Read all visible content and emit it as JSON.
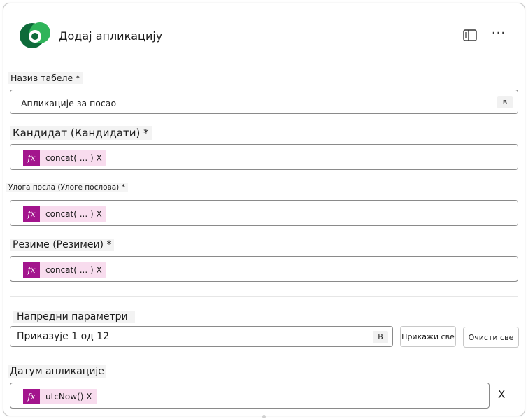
{
  "header": {
    "title": "Додај апликацију",
    "logo_icon": "dataverse-logo-icon",
    "panel_icon": "panel-icon",
    "more_icon": "more-options-icon",
    "more_label": "···"
  },
  "form": {
    "table_name": {
      "label": "Назив табеле *",
      "value": "Апликације за посао",
      "chip": "в"
    },
    "candidate": {
      "label": "Кандидат (Кандидати) *",
      "fx_label": "fx",
      "token": "concat( ... ) X"
    },
    "job_role": {
      "label": "Улога посла (Улоге послова) *",
      "fx_label": "fx",
      "token": "concat( ... ) X"
    },
    "resume": {
      "label": "Резиме (Резимеи) *",
      "fx_label": "fx",
      "token": "concat( ... ) X"
    },
    "advanced": {
      "label": "Напредни параметри",
      "value": "Приказује 1 од 12",
      "chip": "В",
      "show_all": "Прикажи све",
      "clear_all": "Очисти све"
    },
    "application_date": {
      "label": "Датум апликације",
      "fx_label": "fx",
      "token": "utcNow() X",
      "clear_label": "X"
    }
  },
  "colors": {
    "fx_badge": "#a3158d",
    "token_bg": "#f8dcee",
    "logo_dark": "#0b6a3a",
    "logo_light": "#2fb45a"
  }
}
